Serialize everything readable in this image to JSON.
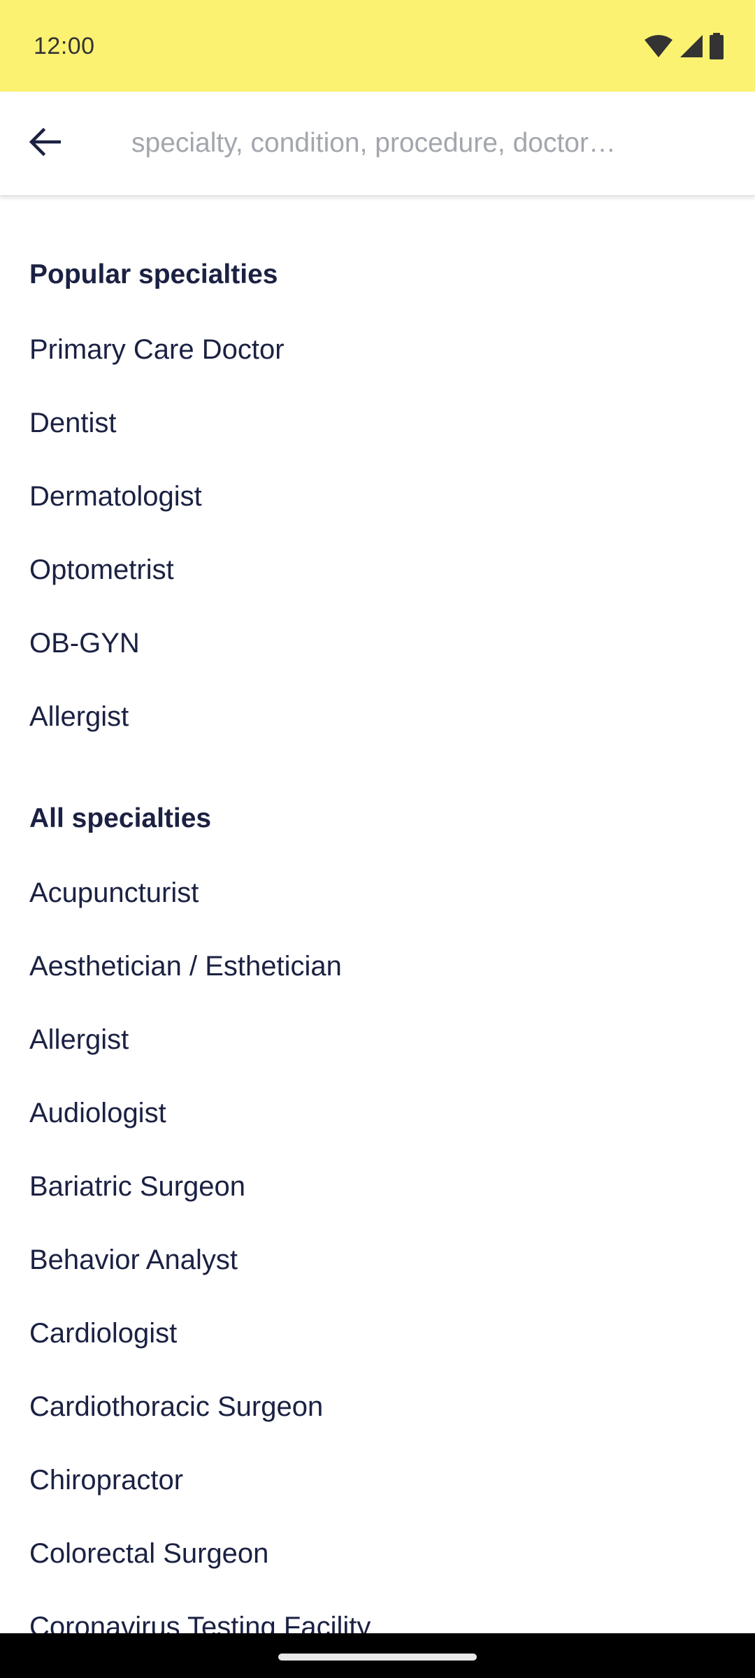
{
  "status_bar": {
    "time": "12:00",
    "background_color": "#fbf272",
    "icons": [
      "wifi-icon",
      "cellular-signal-icon",
      "battery-icon"
    ]
  },
  "search": {
    "placeholder": "specialty, condition, procedure, doctor…",
    "value": ""
  },
  "popular": {
    "heading": "Popular specialties",
    "items": [
      "Primary Care Doctor",
      "Dentist",
      "Dermatologist",
      "Optometrist",
      "OB-GYN",
      "Allergist"
    ]
  },
  "all": {
    "heading": "All specialties",
    "items": [
      "Acupuncturist",
      "Aesthetician / Esthetician",
      "Allergist",
      "Audiologist",
      "Bariatric Surgeon",
      "Behavior Analyst",
      "Cardiologist",
      "Cardiothoracic Surgeon",
      "Chiropractor",
      "Colorectal Surgeon",
      "Coronavirus Testing Facility"
    ]
  },
  "colors": {
    "text": "#1b2142",
    "placeholder": "#a3a6ad"
  }
}
